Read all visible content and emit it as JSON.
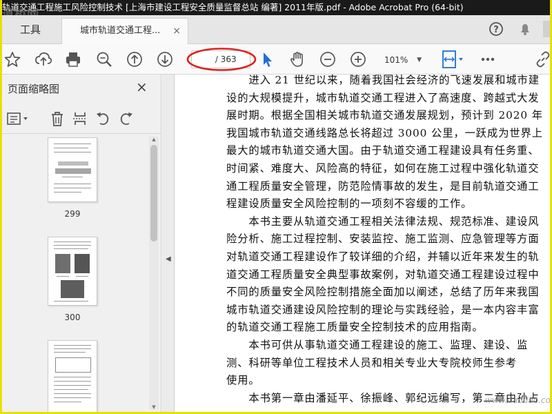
{
  "window": {
    "title": "轨道交通工程施工风险控制技术 [上海市建设工程安全质量监督总站 编著] 2011年版.pdf - Adobe Acrobat Pro (64-bit)",
    "watermark": "道桥网"
  },
  "tabs": {
    "tools_label": "工具",
    "document_label": "城市轨道交通工程...",
    "close_symbol": "×"
  },
  "toolbar": {
    "page_total": "/ 363",
    "zoom": "101%",
    "icons": [
      "bookmark-star-icon",
      "upload-icon",
      "print-icon",
      "find-icon",
      "prev-page-icon",
      "next-page-icon",
      "select-cursor-icon",
      "hand-tool-icon",
      "zoom-out-icon",
      "zoom-in-icon",
      "fit-page-icon",
      "more-icon",
      "share-link-icon"
    ]
  },
  "sidebar": {
    "title": "页面缩略图",
    "close_symbol": "×",
    "thumbnails": [
      {
        "page": "299"
      },
      {
        "page": "300"
      },
      {
        "page": ""
      }
    ]
  },
  "document": {
    "lines": [
      "　　进入 21 世纪以来，随着我国社会经济的飞速发展和城市建",
      "设的大规模提升，城市轨道交通工程进入了高速度、跨越式大发",
      "展时期。根据全国相关城市轨道交通发展规划，预计到 2020 年",
      "我国城市轨道交通线路总长将超过 3000 公里，一跃成为世界上",
      "最大的城市轨道交通大国。由于轨道交通工程建设具有任务重、",
      "时间紧、难度大、风险高的特征，如何在施工过程中强化轨道交",
      "通工程质量安全管理，防范险情事故的发生，是目前轨道交通工",
      "程建设质量安全风险控制的一项刻不容缓的工作。",
      "　　本书主要从轨道交通工程相关法律法规、规范标准、建设风",
      "险分析、施工过程控制、安装监控、施工监测、应急管理等方面",
      "对轨道交通工程建设作了较详细的介绍，并辅以近年来发生的轨",
      "道交通工程质量安全典型事故案例，对轨道交通工程建设过程中",
      "不同的质量安全风险控制措施全面加以阐述，总结了历年来我国",
      "城市轨道交通建设风险控制的理论与实践经验，是一本内容丰富",
      "的轨道交通工程施工质量安全控制技术的应用指南。",
      "　　本书可供从事轨道交通工程建设的施工、监理、建设、监",
      "测、科研等单位工程技术人员和相关专业大专院校师生参考",
      "使用。",
      "　　本书第一章由潘延平、徐振峰、郭纪远编写，第二章由孙占",
      "　　　　　　　　　　　　　　　　　　　　　　　　　　　"
    ],
    "site_watermark": "www.daodao.com"
  },
  "colors": {
    "titlebar": "#1a1a1a",
    "accent_blue": "#1f6fd6",
    "annotation_red": "#e0201c",
    "outer_border": "#e5e200"
  }
}
